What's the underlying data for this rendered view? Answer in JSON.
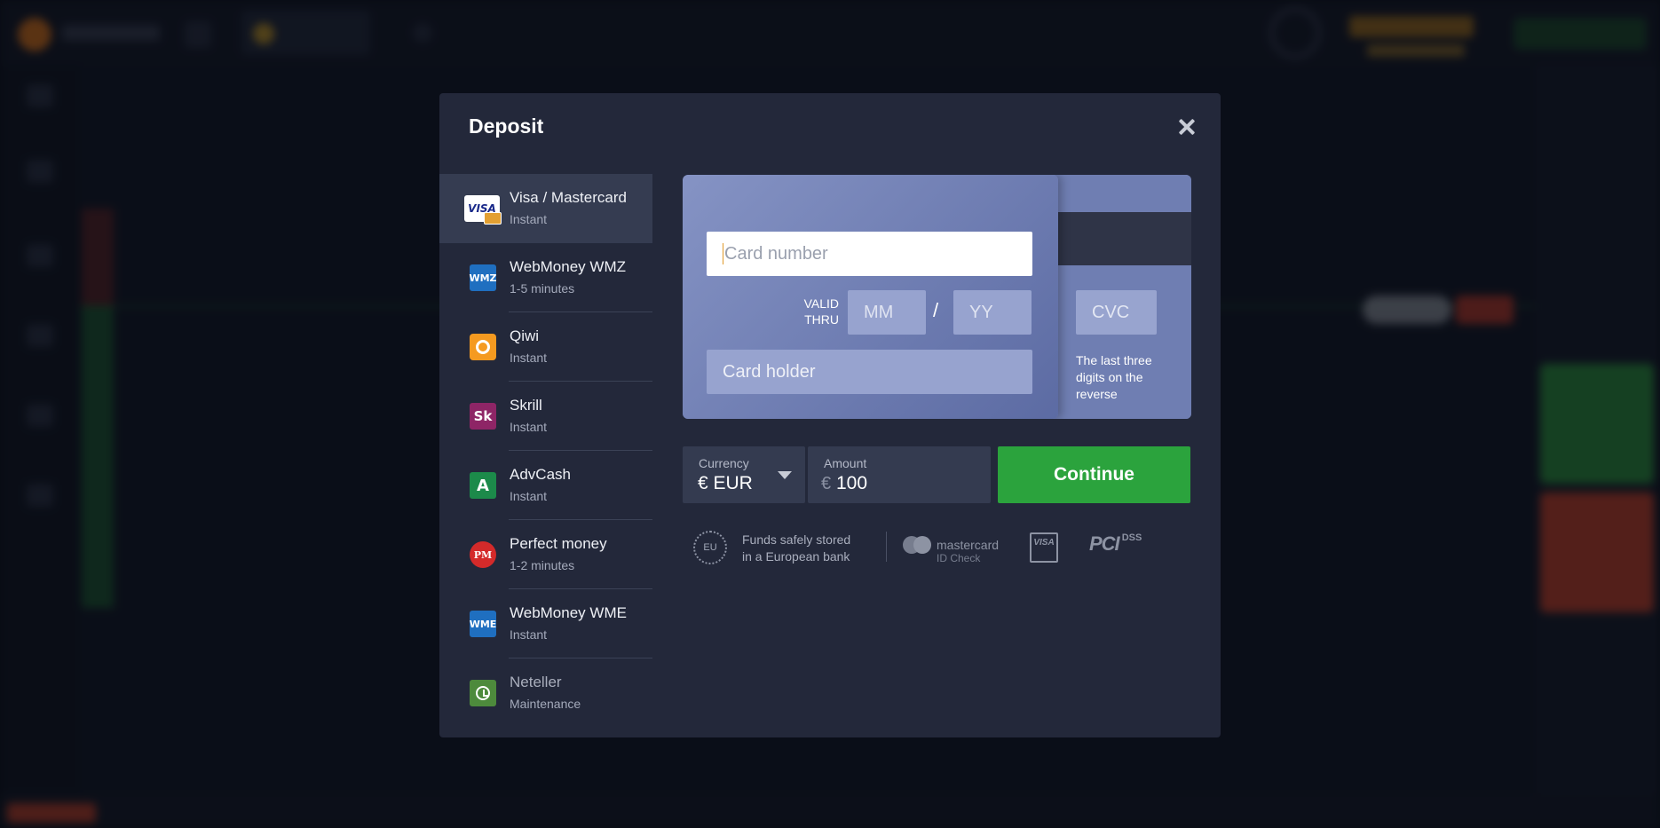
{
  "modal": {
    "title": "Deposit",
    "close_icon": "close-icon"
  },
  "methods": [
    {
      "name": "Visa / Mastercard",
      "sub": "Instant",
      "icon": "visa-card-icon",
      "active": true
    },
    {
      "name": "WebMoney WMZ",
      "sub": "1-5 minutes",
      "icon": "webmoney-wmz-icon"
    },
    {
      "name": "Qiwi",
      "sub": "Instant",
      "icon": "qiwi-icon"
    },
    {
      "name": "Skrill",
      "sub": "Instant",
      "icon": "skrill-icon"
    },
    {
      "name": "AdvCash",
      "sub": "Instant",
      "icon": "advcash-icon"
    },
    {
      "name": "Perfect money",
      "sub": "1-2 minutes",
      "icon": "perfect-money-icon"
    },
    {
      "name": "WebMoney WME",
      "sub": "Instant",
      "icon": "webmoney-wme-icon"
    },
    {
      "name": "Neteller",
      "sub": "Maintenance",
      "icon": "neteller-icon"
    }
  ],
  "icon_glyphs": {
    "visa": "VISA",
    "wmz": "WMZ",
    "skrill": "Sk",
    "advcash": "A",
    "pm": "PM",
    "wme": "WME"
  },
  "card": {
    "number_placeholder": "Card number",
    "valid_thru_1": "VALID",
    "valid_thru_2": "THRU",
    "mm_placeholder": "MM",
    "slash": "/",
    "yy_placeholder": "YY",
    "holder_placeholder": "Card holder",
    "cvc_placeholder": "CVC",
    "cvc_hint": "The last three digits on the reverse"
  },
  "currency": {
    "label": "Currency",
    "value": "€ EUR"
  },
  "amount": {
    "label": "Amount",
    "prefix": "€",
    "value": "100"
  },
  "continue_label": "Continue",
  "trust": {
    "eu": "EU",
    "safe_line_1": "Funds safely stored",
    "safe_line_2": "in a European bank",
    "mastercard": "mastercard",
    "id_check": "ID Check",
    "visa_secure": "VISA",
    "pci": "PCI",
    "dss": "DSS"
  },
  "colors": {
    "modal_bg": "#23283a",
    "continue": "#2ba33d",
    "card": "#6b7bb0"
  }
}
